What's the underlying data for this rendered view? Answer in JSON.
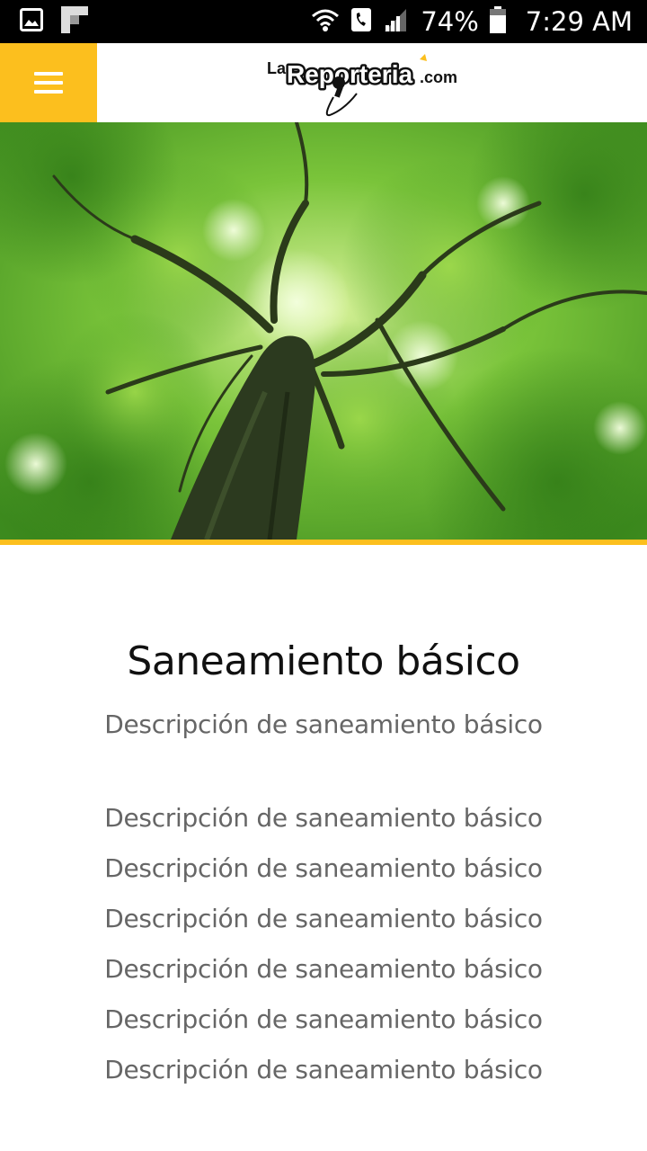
{
  "status_bar": {
    "battery_text": "74%",
    "time": "7:29 AM",
    "icons": [
      "gallery-icon",
      "flipboard-icon",
      "wifi-calling-icon",
      "phone-call-icon",
      "cell-signal-icon",
      "battery-icon"
    ]
  },
  "header": {
    "menu_icon": "hamburger-menu-icon",
    "logo_prefix": "La",
    "logo_main": "Reporteria",
    "logo_suffix": ".com",
    "accent_color": "#fcbf1e"
  },
  "hero": {
    "image": "tree-canopy-photo"
  },
  "content": {
    "title": "Saneamiento básico",
    "description": "Descripción de saneamiento básico",
    "lines": [
      "Descripción de saneamiento básico",
      "Descripción de saneamiento básico",
      "Descripción de saneamiento básico",
      "Descripción de saneamiento básico",
      "Descripción de saneamiento básico",
      "Descripción de saneamiento básico"
    ]
  }
}
